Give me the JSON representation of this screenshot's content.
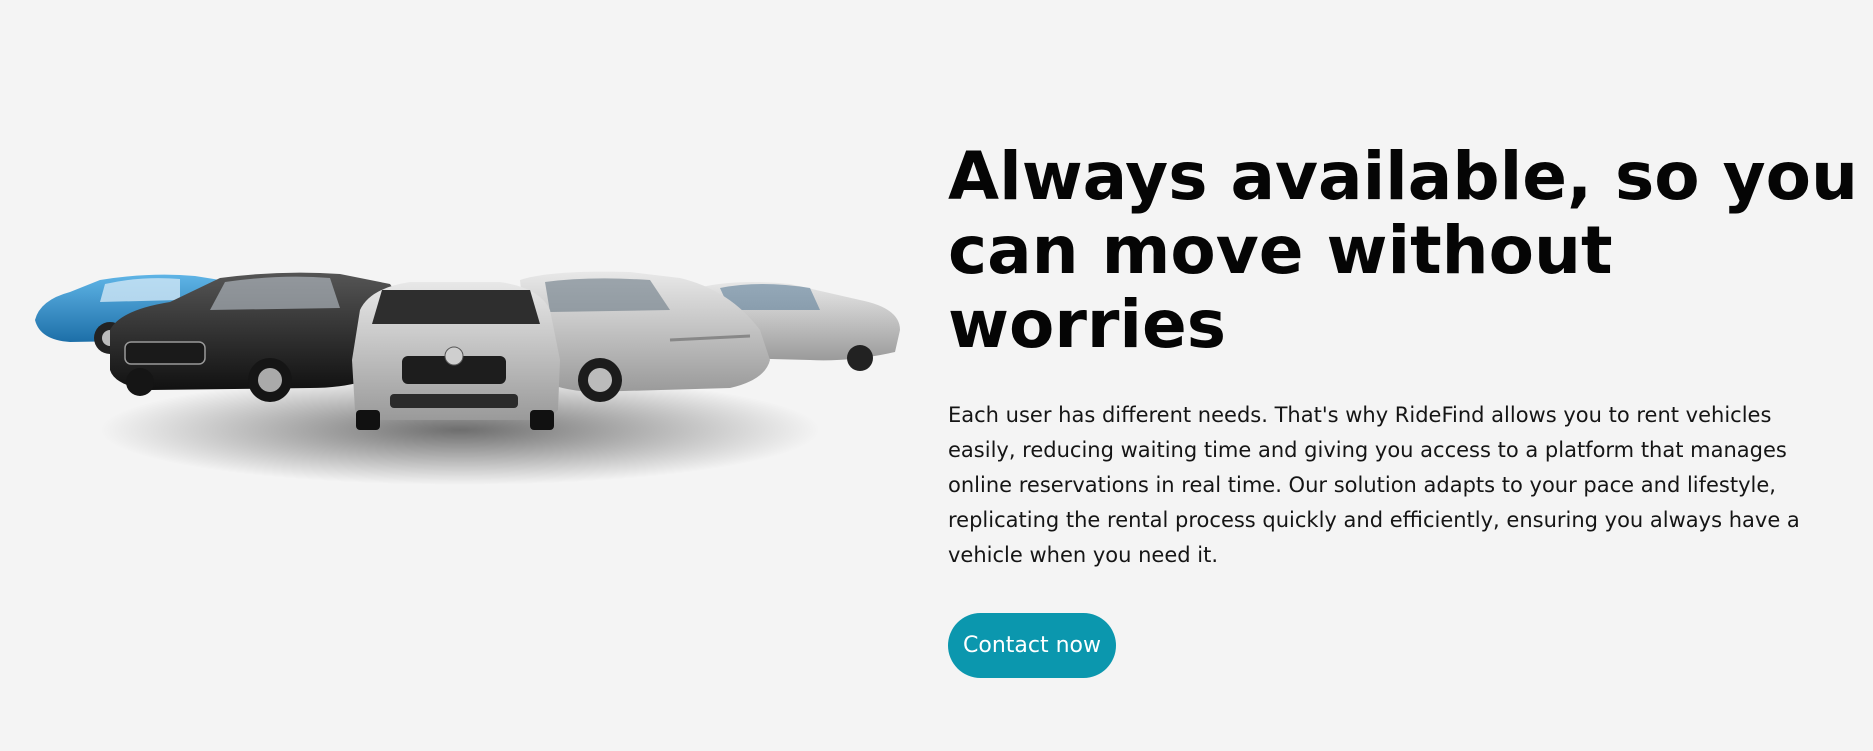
{
  "hero": {
    "headline": "Always available, so you can move without worries",
    "body": "Each user has different needs. That's why RideFind allows you to rent vehicles easily, reducing waiting time and giving you access to a platform that manages online reservations in real time. Our solution adapts to your pace and lifestyle, replicating the rental process quickly and efficiently, ensuring you always have a vehicle when you need it.",
    "cta_label": "Contact now"
  },
  "colors": {
    "background": "#f4f4f4",
    "accent": "#0b97ae",
    "text": "#050505"
  }
}
